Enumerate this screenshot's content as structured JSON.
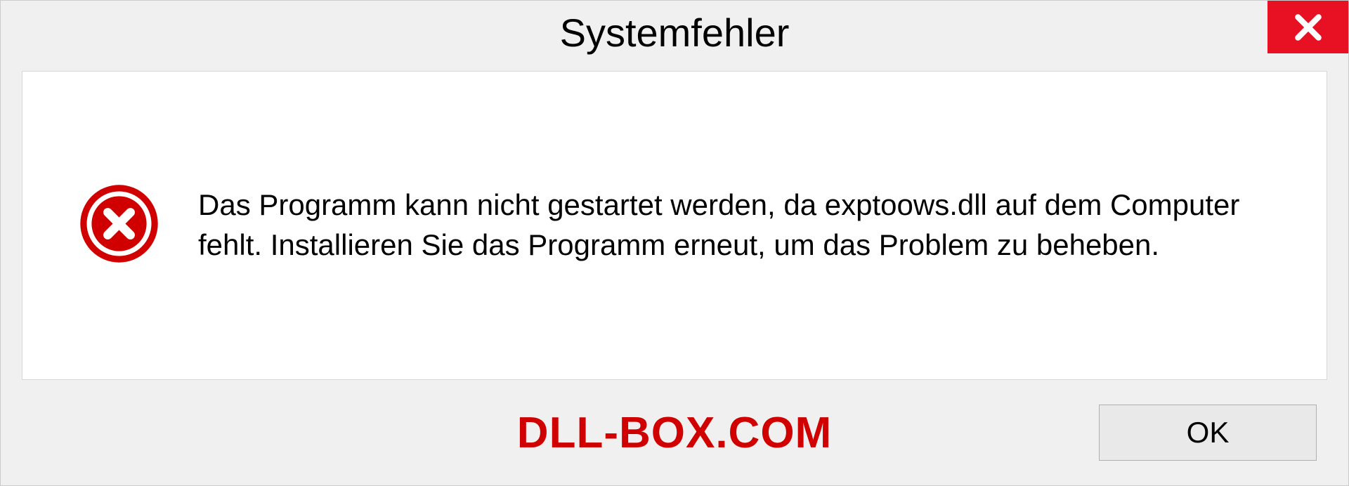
{
  "dialog": {
    "title": "Systemfehler",
    "message": "Das Programm kann nicht gestartet werden, da exptoows.dll auf dem Computer fehlt. Installieren Sie das Programm erneut, um das Problem zu beheben.",
    "ok_label": "OK"
  },
  "watermark": "DLL-BOX.COM"
}
